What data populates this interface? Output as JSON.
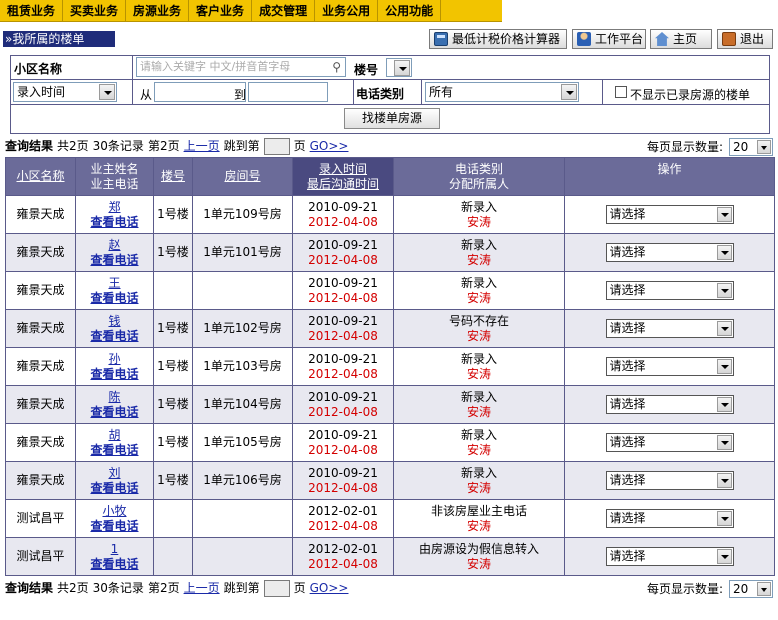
{
  "nav": [
    "租赁业务",
    "买卖业务",
    "房源业务",
    "客户业务",
    "成交管理",
    "业务公用",
    "公用功能"
  ],
  "section_title": "»我所属的楼单",
  "toolbar": {
    "calc_label": "最低计税价格计算器",
    "workbench_label": "工作平台",
    "home_label": "主页",
    "exit_label": "退出"
  },
  "filter": {
    "community_label": "小区名称",
    "search_placeholder": "请输入关键字 中文/拼音首字母",
    "building_label": "楼号",
    "date_type": "录入时间",
    "from_label": "从",
    "to_label": "到",
    "phone_type_label": "电话类别",
    "phone_type_value": "所有",
    "hide_label": "不显示已录房源的楼单",
    "search_button": "找楼单房源"
  },
  "pager": {
    "result_label": "查询结果",
    "total_pages": "共2页",
    "total_records": "30条记录",
    "current_page": "第2页",
    "prev_label": "上一页",
    "jump_label": "跳到第",
    "page_unit": "页",
    "go_label": "GO>>",
    "per_page_label": "每页显示数量:",
    "per_page_value": "20"
  },
  "table": {
    "headers": {
      "community": "小区名称",
      "owner_name": "业主姓名",
      "owner_phone": "业主电话",
      "building": "楼号",
      "room": "房间号",
      "entry_time": "录入时间",
      "last_contact": "最后沟通时间",
      "phone_type": "电话类别",
      "assignee": "分配所属人",
      "action": "操作"
    },
    "view_phone_label": "查看电话",
    "action_option": "请选择",
    "rows": [
      {
        "community": "雍景天成",
        "owner": "郑",
        "building": "1号楼",
        "room": "1单元109号房",
        "entry": "2010-09-21",
        "contact": "2012-04-08",
        "phone_type": "新录入",
        "assignee": "安涛"
      },
      {
        "community": "雍景天成",
        "owner": "赵",
        "building": "1号楼",
        "room": "1单元101号房",
        "entry": "2010-09-21",
        "contact": "2012-04-08",
        "phone_type": "新录入",
        "assignee": "安涛"
      },
      {
        "community": "雍景天成",
        "owner": "王",
        "building": "",
        "room": "",
        "entry": "2010-09-21",
        "contact": "2012-04-08",
        "phone_type": "新录入",
        "assignee": "安涛"
      },
      {
        "community": "雍景天成",
        "owner": "钱",
        "building": "1号楼",
        "room": "1单元102号房",
        "entry": "2010-09-21",
        "contact": "2012-04-08",
        "phone_type": "号码不存在",
        "assignee": "安涛"
      },
      {
        "community": "雍景天成",
        "owner": "孙",
        "building": "1号楼",
        "room": "1单元103号房",
        "entry": "2010-09-21",
        "contact": "2012-04-08",
        "phone_type": "新录入",
        "assignee": "安涛"
      },
      {
        "community": "雍景天成",
        "owner": "陈",
        "building": "1号楼",
        "room": "1单元104号房",
        "entry": "2010-09-21",
        "contact": "2012-04-08",
        "phone_type": "新录入",
        "assignee": "安涛"
      },
      {
        "community": "雍景天成",
        "owner": "胡",
        "building": "1号楼",
        "room": "1单元105号房",
        "entry": "2010-09-21",
        "contact": "2012-04-08",
        "phone_type": "新录入",
        "assignee": "安涛"
      },
      {
        "community": "雍景天成",
        "owner": "刘",
        "building": "1号楼",
        "room": "1单元106号房",
        "entry": "2010-09-21",
        "contact": "2012-04-08",
        "phone_type": "新录入",
        "assignee": "安涛"
      },
      {
        "community": "测试昌平",
        "owner": "小牧",
        "building": "",
        "room": "",
        "entry": "2012-02-01",
        "contact": "2012-04-08",
        "phone_type": "非该房屋业主电话",
        "assignee": "安涛"
      },
      {
        "community": "测试昌平",
        "owner": "1",
        "building": "",
        "room": "",
        "entry": "2012-02-01",
        "contact": "2012-04-08",
        "phone_type": "由房源设为假信息转入",
        "assignee": "安涛"
      }
    ]
  }
}
